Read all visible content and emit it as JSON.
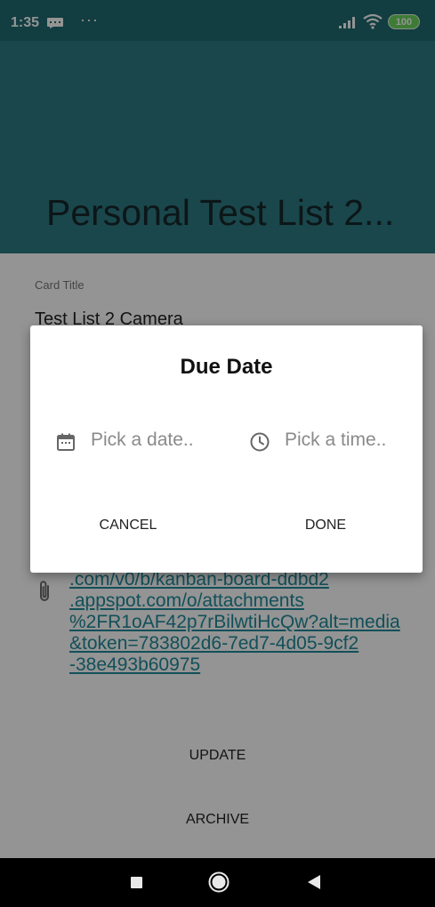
{
  "status_bar": {
    "time": "1:35",
    "more_indicator": "···",
    "battery_level": "100",
    "icons": [
      "message-icon",
      "signal-icon",
      "wifi-icon",
      "battery-icon"
    ]
  },
  "header": {
    "title": "Personal Test List 2..."
  },
  "card": {
    "title_label": "Card Title",
    "title_value": "Test List 2 Camera",
    "attachment_lines": [
      ".com/v0/b/kanban-board-ddbd2",
      ".appspot.com/o/attachments",
      "%2FR1oAF42p7rBilwtiHcQw?alt=media",
      "&token=783802d6-7ed7-4d05-9cf2",
      "-38e493b60975"
    ],
    "update_label": "UPDATE",
    "archive_label": "ARCHIVE"
  },
  "dialog": {
    "title": "Due Date",
    "date_placeholder": "Pick a date..",
    "time_placeholder": "Pick a time..",
    "cancel_label": "CANCEL",
    "done_label": "DONE"
  },
  "colors": {
    "status_bar": "#1f6a70",
    "header": "#2d7a82",
    "link": "#1f8a99",
    "battery": "#6cd65e"
  }
}
